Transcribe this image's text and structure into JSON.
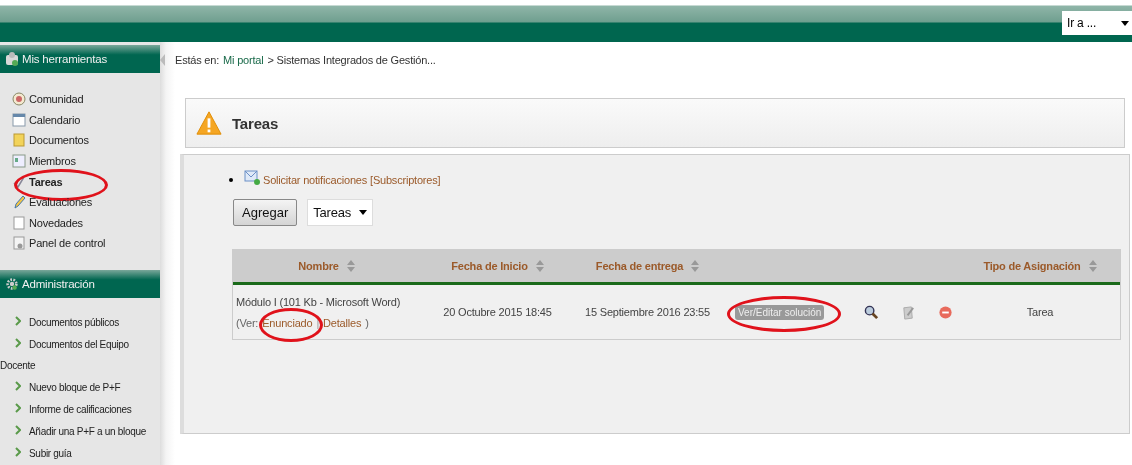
{
  "header": {
    "goto_select": "Ir a ..."
  },
  "sidebar": {
    "sections": [
      {
        "title": "Mis herramientas",
        "kind": "tools",
        "items": [
          {
            "label": "Comunidad",
            "selected": false,
            "circled": false
          },
          {
            "label": "Calendario",
            "selected": false,
            "circled": false
          },
          {
            "label": "Documentos",
            "selected": false,
            "circled": false
          },
          {
            "label": "Miembros",
            "selected": false,
            "circled": false
          },
          {
            "label": "Tareas",
            "selected": true,
            "circled": true
          },
          {
            "label": "Evaluaciones",
            "selected": false,
            "circled": false
          },
          {
            "label": "Novedades",
            "selected": false,
            "circled": false
          },
          {
            "label": "Panel de control",
            "selected": false,
            "circled": false
          }
        ]
      },
      {
        "title": "Administración",
        "kind": "admin",
        "items": [
          {
            "label": "Documentos públicos",
            "selected": false,
            "circled": false
          },
          {
            "label": "Documentos del Equipo Docente",
            "selected": false,
            "circled": false
          },
          {
            "label": "Nuevo bloque de P+F",
            "selected": false,
            "circled": false
          },
          {
            "label": "Informe de calificaciones",
            "selected": false,
            "circled": false
          },
          {
            "label": "Añadir una P+F a un bloque",
            "selected": false,
            "circled": false
          },
          {
            "label": "Subir guía",
            "selected": false,
            "circled": false
          }
        ]
      }
    ]
  },
  "breadcrumb": {
    "prefix": "Estás en:",
    "link": "Mi portal",
    "rest": "> Sistemas Integrados de Gestión..."
  },
  "panel": {
    "title": "Tareas",
    "notify": {
      "link": "Solicitar notificaciones",
      "extra": "[Subscriptores]"
    },
    "add_button": "Agregar",
    "filter_select": "Tareas",
    "table": {
      "columns": [
        {
          "label": "Nombre",
          "kind": "sortable"
        },
        {
          "label": "Fecha de Inicio",
          "kind": "sortable"
        },
        {
          "label": "Fecha de entrega",
          "kind": "sortable"
        },
        {
          "kind": "actions"
        },
        {
          "label": "Tipo de Asignación",
          "kind": "sortable"
        }
      ],
      "rows": [
        {
          "file": "Módulo I (101 Kb - Microsoft Word)",
          "links_open": "(Ver:",
          "links": [
            {
              "label": "Enunciado",
              "circled": true
            },
            {
              "label": "Detalles",
              "circled": false
            }
          ],
          "links_sep": "|",
          "links_close": ")",
          "start": "20 Octubre 2015 18:45",
          "due": "15 Septiembre 2016 23:55",
          "action": {
            "label": "Ver/Editar solución",
            "circled": true
          },
          "type": "Tarea"
        }
      ]
    }
  }
}
